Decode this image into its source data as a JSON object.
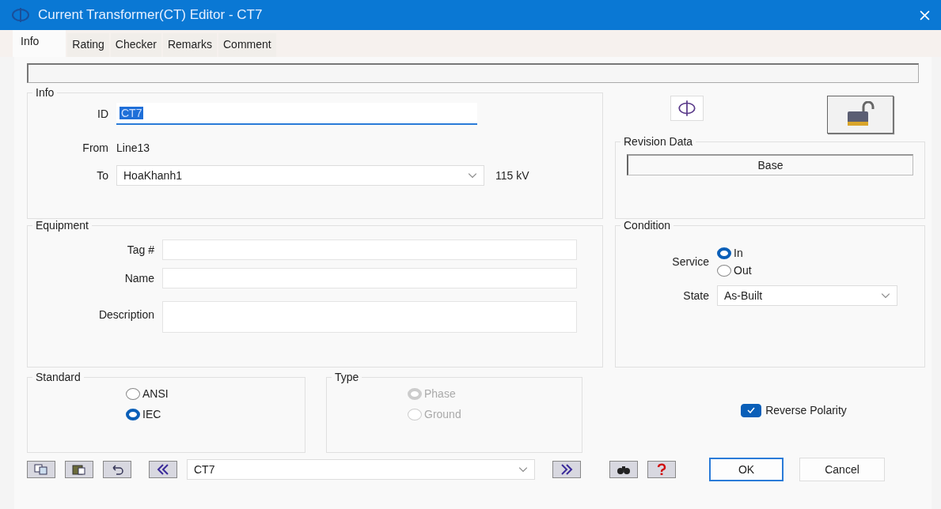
{
  "window": {
    "title": "Current Transformer(CT) Editor - CT7"
  },
  "tabs": [
    {
      "label": "Info",
      "selected": true
    },
    {
      "label": "Rating",
      "selected": false
    },
    {
      "label": "Checker",
      "selected": false
    },
    {
      "label": "Remarks",
      "selected": false
    },
    {
      "label": "Comment",
      "selected": false
    }
  ],
  "info": {
    "title": "Info",
    "id_label": "ID",
    "id_value": "CT7",
    "from_label": "From",
    "from_value": "Line13",
    "to_label": "To",
    "to_value": "HoaKhanh1",
    "voltage": "115 kV"
  },
  "revision": {
    "title": "Revision Data",
    "value": "Base"
  },
  "equipment": {
    "title": "Equipment",
    "fields": [
      {
        "label": "Tag #",
        "tall": false
      },
      {
        "label": "Name",
        "tall": false
      },
      {
        "label": "Description",
        "tall": true
      }
    ]
  },
  "condition": {
    "title": "Condition",
    "service_label": "Service",
    "service_options": [
      {
        "label": "In",
        "selected": true
      },
      {
        "label": "Out",
        "selected": false
      }
    ],
    "state_label": "State",
    "state_value": "As-Built"
  },
  "standard": {
    "title": "Standard",
    "options": [
      {
        "label": "ANSI",
        "selected": false
      },
      {
        "label": "IEC",
        "selected": true
      }
    ]
  },
  "type": {
    "title": "Type",
    "disabled": true,
    "options": [
      {
        "label": "Phase",
        "selected": true
      },
      {
        "label": "Ground",
        "selected": false
      }
    ]
  },
  "reverse_polarity": {
    "label": "Reverse Polarity",
    "checked": true
  },
  "navigator": {
    "value": "CT7"
  },
  "buttons": [
    {
      "label": "OK",
      "default": true
    },
    {
      "label": "Cancel",
      "default": false
    }
  ]
}
